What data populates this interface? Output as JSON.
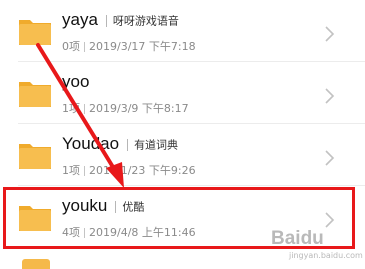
{
  "colors": {
    "folder": "#f7be4f",
    "folder_tab": "#f0ab2c",
    "highlight": "#e8181a",
    "arrow": "#e8181a"
  },
  "folders": [
    {
      "name": "yaya",
      "tag": "呀呀游戏语音",
      "count": "0项",
      "date": "2019/3/17 下午7:18"
    },
    {
      "name": "yoo",
      "tag": "",
      "count": "1项",
      "date": "2019/3/9 下午8:17"
    },
    {
      "name": "Youdao",
      "tag": "有道词典",
      "count": "1项",
      "date": "2019/1/23 下午9:26"
    },
    {
      "name": "youku",
      "tag": "优酷",
      "count": "4项",
      "date": "2019/4/8 上午11:46"
    }
  ],
  "watermark": {
    "text": "Baidu",
    "sub": "jingyan.baidu.com"
  }
}
